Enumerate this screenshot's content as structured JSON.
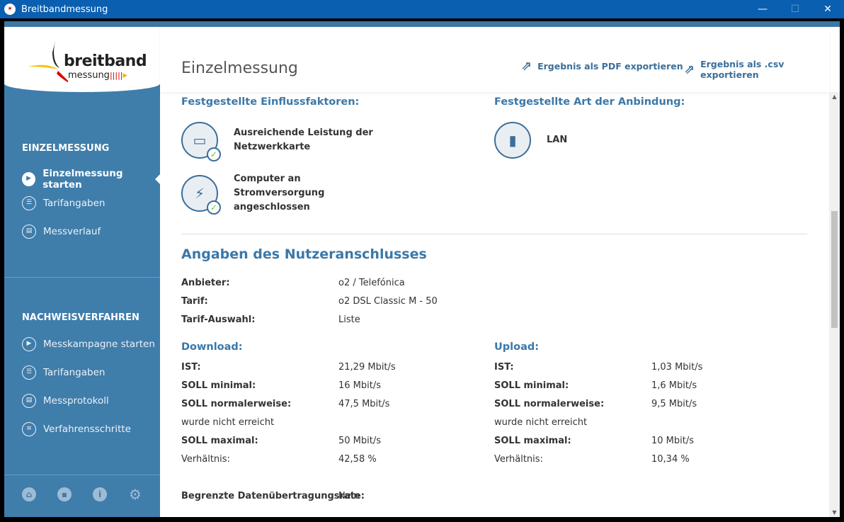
{
  "window": {
    "title": "Breitbandmessung",
    "minimize": "—",
    "maximize": "☐",
    "close": "✕"
  },
  "logo": {
    "line1": "breitband",
    "line2": "messung",
    "bars": "|||||"
  },
  "sidebar": {
    "section1": "EINZELMESSUNG",
    "items1": [
      {
        "label": "Einzelmessung starten",
        "icon": "play-icon"
      },
      {
        "label": "Tarifangaben",
        "icon": "user-tariff-icon"
      },
      {
        "label": "Messverlauf",
        "icon": "calendar-icon"
      }
    ],
    "section2": "NACHWEISVERFAHREN",
    "items2": [
      {
        "label": "Messkampagne starten",
        "icon": "play-icon"
      },
      {
        "label": "Tarifangaben",
        "icon": "user-tariff-icon"
      },
      {
        "label": "Messprotokoll",
        "icon": "calendar-icon"
      },
      {
        "label": "Verfahrensschritte",
        "icon": "list-icon"
      }
    ],
    "bottom_icons": [
      "home-icon",
      "chat-icon",
      "info-icon",
      "gear-icon"
    ]
  },
  "header": {
    "title": "Einzelmessung",
    "export_pdf": "Ergebnis als PDF exportieren",
    "export_csv": "Ergebnis als .csv exportieren"
  },
  "factors": {
    "title": "Festgestellte Einflussfaktoren:",
    "items": [
      "Ausreichende Leistung der Netzwerkkarte",
      "Computer an Stromversorgung angeschlossen"
    ]
  },
  "connection": {
    "title": "Festgestellte Art der Anbindung:",
    "value": "LAN"
  },
  "user": {
    "title": "Angaben des Nutzeranschlusses",
    "rows": [
      {
        "label": "Anbieter:",
        "value": "o2 / Telefónica"
      },
      {
        "label": "Tarif:",
        "value": "o2 DSL Classic M - 50"
      },
      {
        "label": "Tarif-Auswahl:",
        "value": "Liste"
      }
    ]
  },
  "download": {
    "title": "Download:",
    "ist_label": "IST:",
    "ist": "21,29 Mbit/s",
    "min_label": "SOLL minimal:",
    "min": "16 Mbit/s",
    "norm_label": "SOLL normalerweise:",
    "norm": "47,5 Mbit/s",
    "note": "wurde nicht erreicht",
    "max_label": "SOLL maximal:",
    "max": "50 Mbit/s",
    "ratio_label": "Verhältnis:",
    "ratio": "42,58 %"
  },
  "upload": {
    "title": "Upload:",
    "ist_label": "IST:",
    "ist": "1,03 Mbit/s",
    "min_label": "SOLL minimal:",
    "min": "1,6 Mbit/s",
    "norm_label": "SOLL normalerweise:",
    "norm": "9,5 Mbit/s",
    "note": "wurde nicht erreicht",
    "max_label": "SOLL maximal:",
    "max": "10 Mbit/s",
    "ratio_label": "Verhältnis:",
    "ratio": "10,34 %"
  },
  "limit": {
    "label": "Begrenzte Datenübertragungsrate:",
    "value": "Nein"
  }
}
